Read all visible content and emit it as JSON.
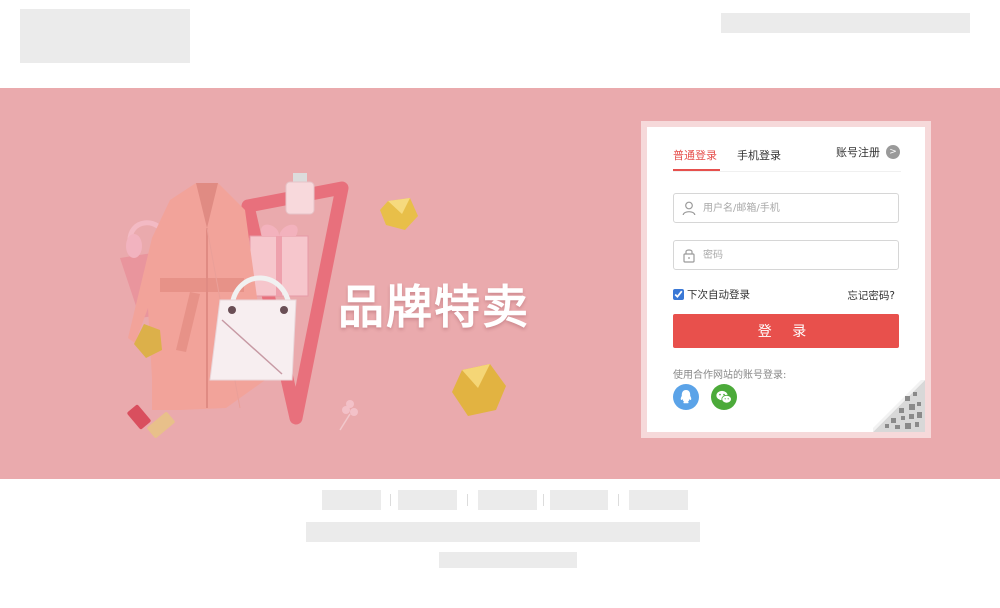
{
  "hero": {
    "title": "品牌特卖"
  },
  "login": {
    "tabs": [
      {
        "label": "普通登录",
        "active": true
      },
      {
        "label": "手机登录",
        "active": false
      }
    ],
    "register_label": "账号注册",
    "register_icon": "chevron-right-icon",
    "username_placeholder": "用户名/邮箱/手机",
    "password_placeholder": "密码",
    "remember_label": "下次自动登录",
    "remember_checked": true,
    "forgot_label": "忘记密码?",
    "submit_label": "登 录",
    "partner_label": "使用合作网站的账号登录:",
    "partners": [
      {
        "icon": "qq-icon",
        "color": "#5ba3e8"
      },
      {
        "icon": "wechat-icon",
        "color": "#4caa3a"
      }
    ],
    "qr_icon": "qr-code-icon"
  },
  "colors": {
    "banner_bg": "#eaaaad",
    "accent": "#e8504c",
    "placeholder_block": "#ebebeb"
  }
}
